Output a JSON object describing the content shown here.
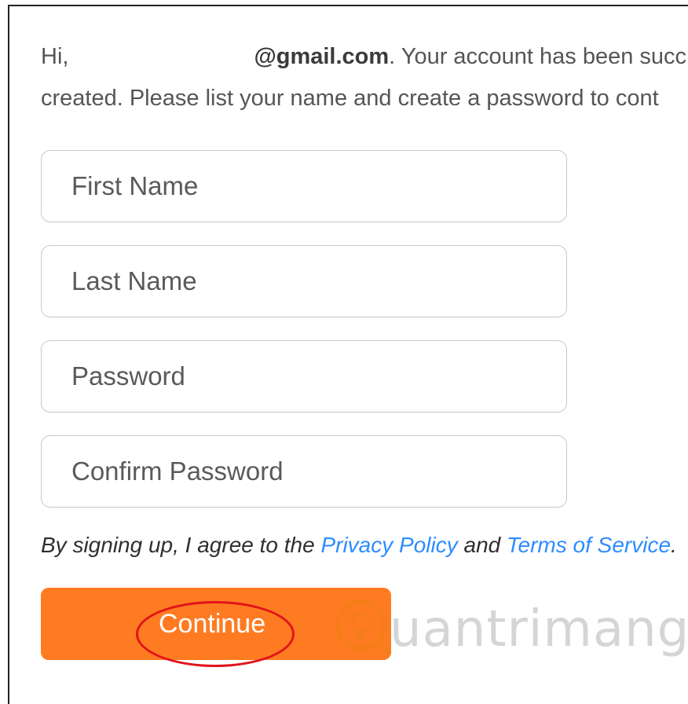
{
  "intro": {
    "greeting": "Hi,",
    "email": "@gmail.com",
    "line1_rest": ". Your account has been succ",
    "line2": "created. Please list your name and create a password to cont"
  },
  "form": {
    "first_name_placeholder": "First Name",
    "last_name_placeholder": "Last Name",
    "password_placeholder": "Password",
    "confirm_password_placeholder": "Confirm Password"
  },
  "terms": {
    "prefix": "By signing up, I agree to the ",
    "privacy_link": "Privacy Policy",
    "middle": " and ",
    "terms_link": "Terms of Service",
    "suffix": "."
  },
  "continue_label": "Continue",
  "watermark": {
    "text": "uantrimang",
    "icon": "lightbulb-icon"
  },
  "colors": {
    "button_orange": "#ff7b22",
    "link_blue": "#2d8cff",
    "highlight_red": "#e0141a"
  }
}
